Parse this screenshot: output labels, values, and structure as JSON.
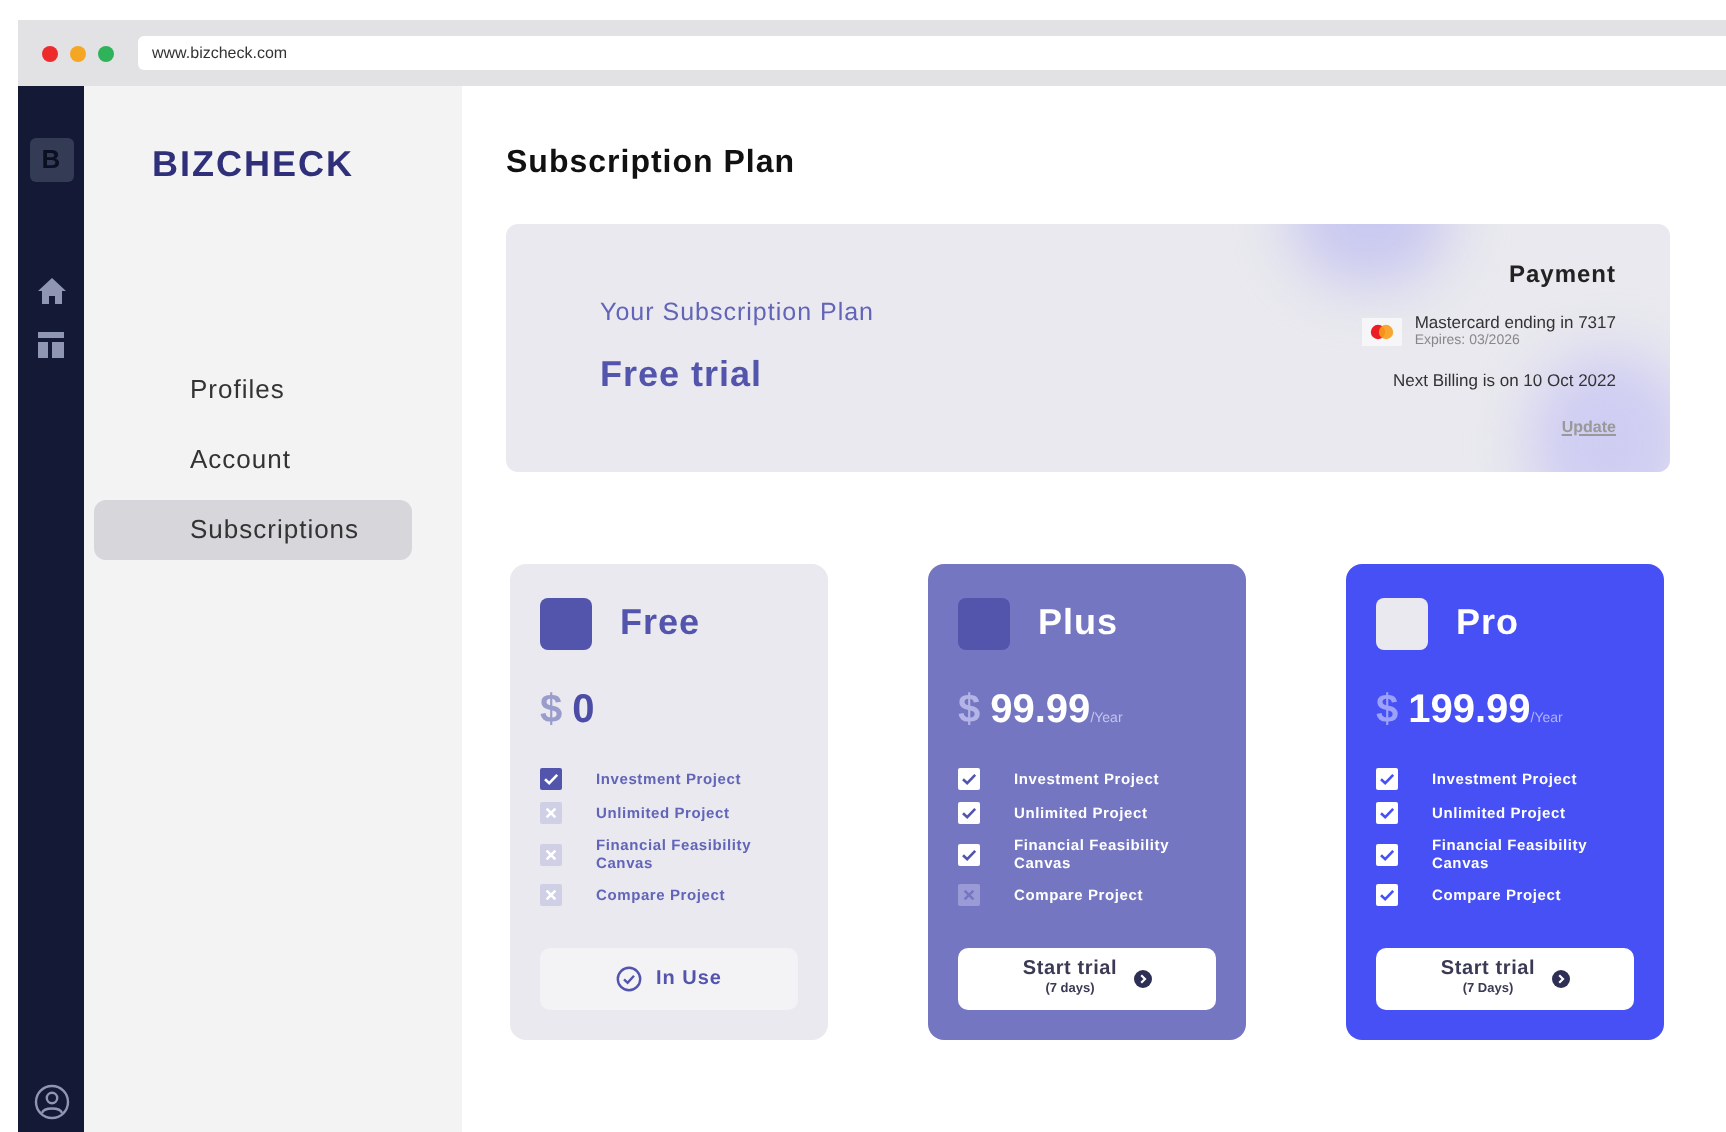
{
  "browser": {
    "url": "www.bizcheck.com"
  },
  "rail": {
    "logo_letter": "B"
  },
  "sidebar": {
    "brand": "BIZCHECK",
    "items": [
      {
        "label": "Profiles",
        "selected": false
      },
      {
        "label": "Account",
        "selected": false
      },
      {
        "label": "Subscriptions",
        "selected": true
      }
    ]
  },
  "page_title": "Subscription Plan",
  "summary": {
    "caption": "Your Subscription Plan",
    "plan": "Free trial",
    "payment_title": "Payment",
    "card": "Mastercard ending in 7317",
    "expires": "Expires: 03/2026",
    "next_billing": "Next Billing is on 10 Oct 2022",
    "update": "Update"
  },
  "plans": [
    {
      "kind": "free",
      "name": "Free",
      "currency": "$",
      "price": "0",
      "features": [
        {
          "label": "Investment Project",
          "included": true
        },
        {
          "label": "Unlimited Project",
          "included": false
        },
        {
          "label": "Financial Feasibility Canvas",
          "included": false
        },
        {
          "label": "Compare Project",
          "included": false
        }
      ],
      "button": {
        "kind": "current",
        "label": "In Use"
      }
    },
    {
      "kind": "plus",
      "name": "Plus",
      "currency": "$",
      "price": "99.99",
      "period": "/Year",
      "features": [
        {
          "label": "Investment Project",
          "included": true
        },
        {
          "label": "Unlimited Project",
          "included": true
        },
        {
          "label": "Financial Feasibility Canvas",
          "included": true
        },
        {
          "label": "Compare Project",
          "included": false
        }
      ],
      "button": {
        "kind": "trial",
        "label": "Start trial",
        "sublabel": "(7 days)"
      }
    },
    {
      "kind": "pro",
      "name": "Pro",
      "currency": "$",
      "price": "199.99",
      "period": "/Year",
      "features": [
        {
          "label": "Investment Project",
          "included": true
        },
        {
          "label": "Unlimited Project",
          "included": true
        },
        {
          "label": "Financial Feasibility Canvas",
          "included": true
        },
        {
          "label": "Compare Project",
          "included": true
        }
      ],
      "button": {
        "kind": "trial",
        "label": "Start trial",
        "sublabel": "(7 Days)"
      }
    }
  ]
}
